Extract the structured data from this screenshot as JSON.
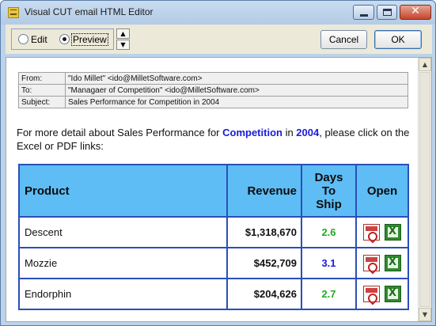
{
  "window": {
    "title": "Visual CUT email HTML Editor"
  },
  "toolbar": {
    "mode_options": [
      {
        "label": "Edit",
        "selected": false
      },
      {
        "label": "Preview",
        "selected": true
      }
    ],
    "spin_up_glyph": "▲",
    "spin_down_glyph": "▼",
    "cancel_label": "Cancel",
    "ok_label": "OK"
  },
  "email_header": {
    "from_label": "From:",
    "from_value": "\"Ido Millet\" <ido@MilletSoftware.com>",
    "to_label": "To:",
    "to_value": "\"Managaer of Competition\" <ido@MilletSoftware.com>",
    "subject_label": "Subject:",
    "subject_value": "Sales Performance for Competition in 2004"
  },
  "intro": {
    "part1": "For more detail about Sales Performance for ",
    "entity": "Competition",
    "part2": " in ",
    "year": "2004",
    "part3": ", please click on the Excel or PDF links:"
  },
  "sales_table": {
    "headers": {
      "product": "Product",
      "revenue": "Revenue",
      "days_line1": "Days",
      "days_line2": "To",
      "days_line3": "Ship",
      "open": "Open"
    },
    "rows": [
      {
        "product": "Descent",
        "revenue": "$1,318,670",
        "days": "2.6",
        "days_color": "#22aa22"
      },
      {
        "product": "Mozzie",
        "revenue": "$452,709",
        "days": "3.1",
        "days_color": "#1a1adc"
      },
      {
        "product": "Endorphin",
        "revenue": "$204,626",
        "days": "2.7",
        "days_color": "#22aa22"
      }
    ]
  },
  "colors": {
    "header_bg": "#5ebdf5",
    "table_border": "#2a4fb8",
    "highlight_blue": "#1a1adc",
    "good_green": "#22aa22"
  },
  "icons": {
    "pdf": "pdf-icon",
    "excel": "excel-icon"
  }
}
